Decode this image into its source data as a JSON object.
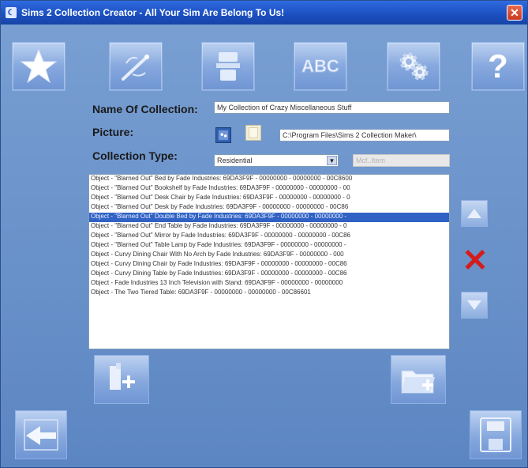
{
  "window": {
    "title": "Sims 2 Collection Creator - All Your Sim Are Belong To Us!",
    "icon_glyph": "☾",
    "close_glyph": "✕"
  },
  "toolbar": {
    "new_icon": "star-icon",
    "wand_icon": "magic-wand-icon",
    "object_icon": "object-icon",
    "abc_label": "ABC",
    "settings_icon": "gears-icon",
    "help_label": "?"
  },
  "form": {
    "name_label": "Name Of Collection:",
    "name_value": "My Collection of Crazy Miscellaneous Stuff",
    "picture_label": "Picture:",
    "picture_path": "C:\\Program Files\\Sims 2 Collection Maker\\",
    "type_label": "Collection Type:",
    "type_value": "Residential",
    "disabled_value": "Mcf..Item"
  },
  "objects": [
    "Object - \"Blarned Out\" Bed by Fade Industries: 69DA3F9F - 00000000 - 00000000 - 00C8600",
    "Object - \"Blarned Out\" Bookshelf by Fade Industries: 69DA3F9F - 00000000 - 00000000 - 00",
    "Object - \"Blarned Out\" Desk Chair by Fade Industries: 69DA3F9F - 00000000 - 00000000 - 0",
    "Object - \"Blarned Out\" Desk by Fade Industries: 69DA3F9F - 00000000 - 00000000 - 00C86",
    "Object - \"Blarned Out\" Double Bed by Fade Industries: 69DA3F9F - 00000000 - 00000000 -",
    "Object - \"Blarned Out\" End Table by Fade Industries: 69DA3F9F - 00000000 - 00000000 - 0",
    "Object - \"Blarned Out\" Mirror by Fade Industries: 69DA3F9F - 00000000 - 00000000 - 00C86",
    "Object - \"Blarned Out\" Table Lamp by Fade Industries: 69DA3F9F - 00000000 - 00000000 -",
    "Object - Curvy Dining Chair With No Arch by Fade Industries: 69DA3F9F - 00000000 - 000",
    "Object - Curvy Dining Chair by Fade Industries: 69DA3F9F - 00000000 - 00000000 - 00C86",
    "Object - Curvy Dining Table by Fade Industries: 69DA3F9F - 00000000 - 00000000 - 00C86",
    "Object - Fade Industries 13 Inch Television with Stand: 69DA3F9F - 00000000 - 00000000",
    "Object - The Two Tiered Table: 69DA3F9F - 00000000 - 00000000 - 00C86601"
  ],
  "selected_index": 4,
  "side": {
    "up_icon": "arrow-up-icon",
    "delete_glyph": "✕",
    "down_icon": "arrow-down-icon"
  },
  "colors": {
    "title_bar": "#1b4fc0",
    "selection": "#3062c4",
    "delete_red": "#d41c1c"
  }
}
